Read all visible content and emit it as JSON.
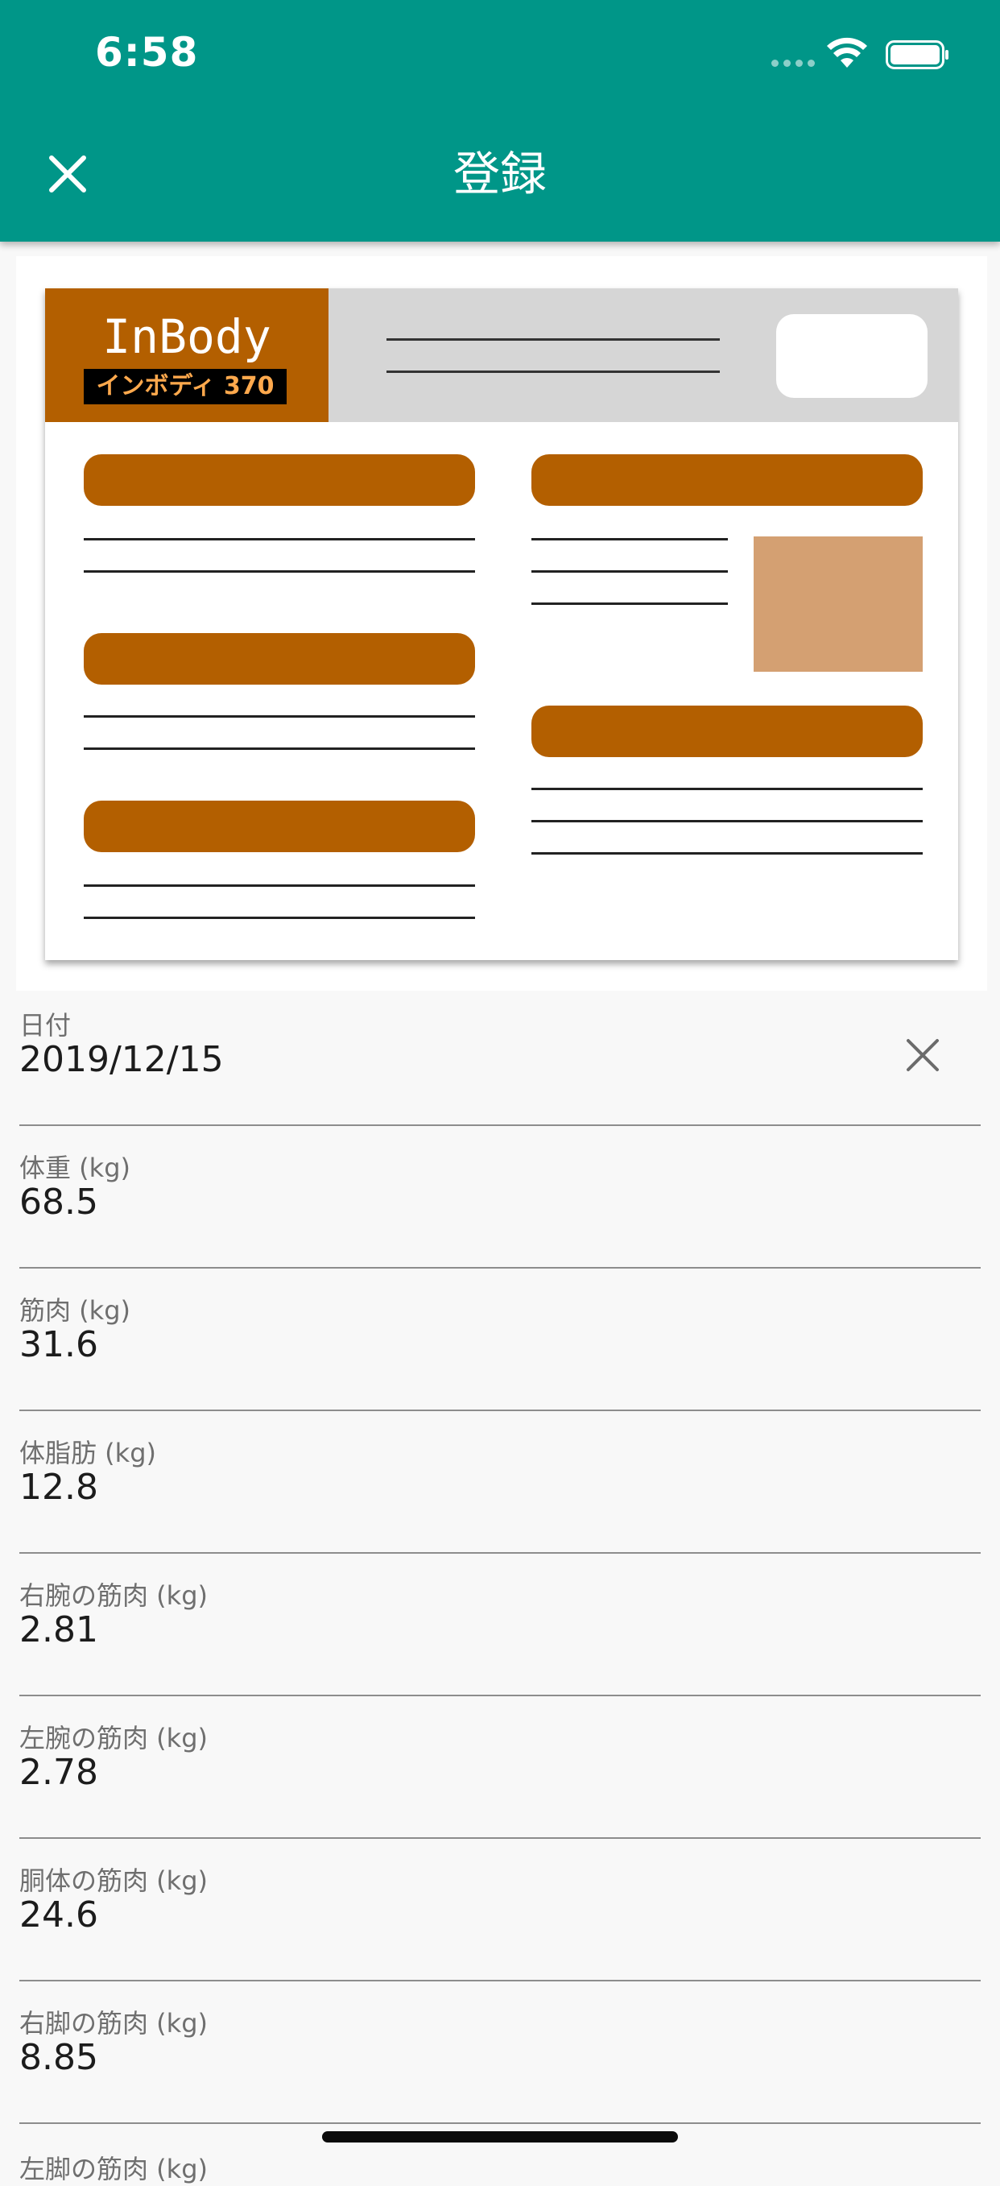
{
  "status_bar": {
    "time": "6:58"
  },
  "header": {
    "title": "登録",
    "close_icon": "close-icon"
  },
  "illustration": {
    "logo_text": "InBody",
    "logo_subtext": "インボディ 370"
  },
  "form": {
    "date": {
      "label": "日付",
      "value": "2019/12/15",
      "clear_icon": "close-icon"
    },
    "fields": [
      {
        "label": "体重 (kg)",
        "value": "68.5"
      },
      {
        "label": "筋肉 (kg)",
        "value": "31.6"
      },
      {
        "label": "体脂肪 (kg)",
        "value": "12.8"
      },
      {
        "label": "右腕の筋肉 (kg)",
        "value": "2.81"
      },
      {
        "label": "左腕の筋肉 (kg)",
        "value": "2.78"
      },
      {
        "label": "胴体の筋肉 (kg)",
        "value": "24.6"
      },
      {
        "label": "右脚の筋肉 (kg)",
        "value": "8.85"
      }
    ],
    "partial_label": "左脚の筋肉 (kg)"
  },
  "colors": {
    "app_bar": "#009688",
    "brand_orange": "#b35f00",
    "muscle_block": "#d4a072",
    "label_gray": "#6f6f6f"
  }
}
